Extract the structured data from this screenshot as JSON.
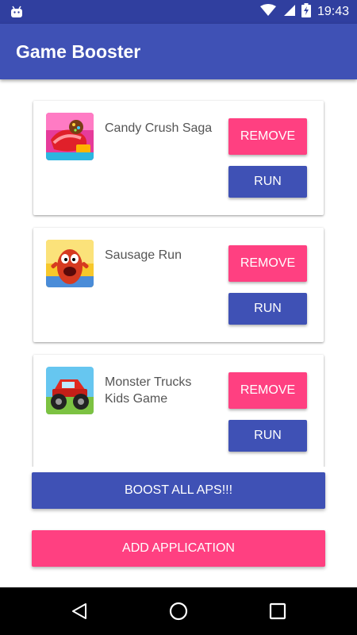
{
  "status_bar": {
    "time": "19:43",
    "icons": [
      "android-notification-icon",
      "wifi-icon",
      "signal-icon",
      "battery-charging-icon"
    ]
  },
  "toolbar": {
    "title": "Game Booster"
  },
  "apps": [
    {
      "name": "Candy Crush Saga",
      "icon": "candy-crush-icon",
      "remove_label": "REMOVE",
      "run_label": "RUN"
    },
    {
      "name": "Sausage Run",
      "icon": "sausage-run-icon",
      "remove_label": "REMOVE",
      "run_label": "RUN"
    },
    {
      "name": "Monster Trucks Kids Game",
      "icon": "monster-trucks-icon",
      "remove_label": "REMOVE",
      "run_label": "RUN"
    }
  ],
  "actions": {
    "boost_label": "BOOST ALL APS!!!",
    "add_label": "ADD APPLICATION"
  },
  "colors": {
    "primary": "#3f51b5",
    "primary_dark": "#303f9f",
    "accent": "#ff4081"
  },
  "nav_bar": [
    "back-icon",
    "home-icon",
    "recents-icon"
  ]
}
